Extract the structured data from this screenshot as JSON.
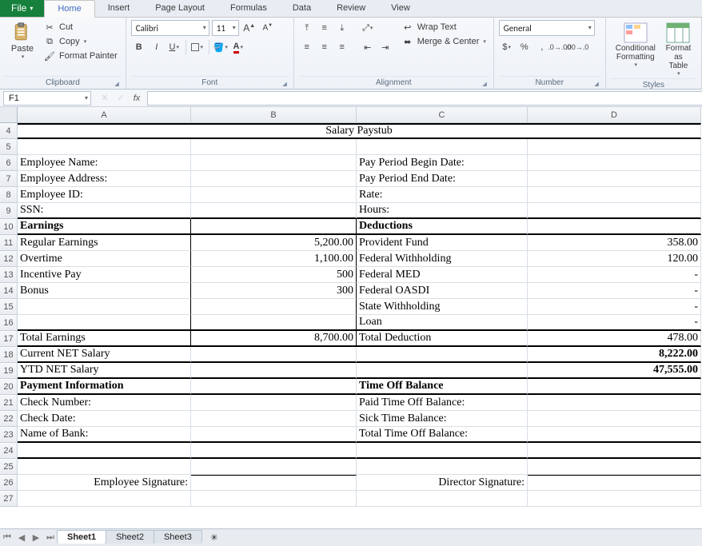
{
  "tabs": {
    "file": "File",
    "items": [
      "Home",
      "Insert",
      "Page Layout",
      "Formulas",
      "Data",
      "Review",
      "View"
    ],
    "active": "Home"
  },
  "ribbon": {
    "clipboard": {
      "label": "Clipboard",
      "paste": "Paste",
      "cut": "Cut",
      "copy": "Copy",
      "painter": "Format Painter"
    },
    "font": {
      "label": "Font",
      "family": "Calibri",
      "size": "11"
    },
    "alignment": {
      "label": "Alignment",
      "wrap": "Wrap Text",
      "merge": "Merge & Center"
    },
    "number": {
      "label": "Number",
      "format": "General"
    },
    "styles": {
      "label": "Styles",
      "cond": "Conditional Formatting",
      "table": "Format as Table"
    }
  },
  "formula_bar": {
    "cell_ref": "F1",
    "fx": "fx",
    "value": ""
  },
  "columns": [
    "A",
    "B",
    "C",
    "D"
  ],
  "rows": [
    "4",
    "5",
    "6",
    "7",
    "8",
    "9",
    "10",
    "11",
    "12",
    "13",
    "14",
    "15",
    "16",
    "17",
    "18",
    "19",
    "20",
    "21",
    "22",
    "23",
    "24",
    "25",
    "26",
    "27"
  ],
  "doc": {
    "title": "Salary Paystub",
    "r6a": "Employee Name:",
    "r6c": "Pay Period Begin Date:",
    "r7a": "Employee Address:",
    "r7c": "Pay Period End Date:",
    "r8a": "Employee ID:",
    "r8c": "Rate:",
    "r9a": "SSN:",
    "r9c": "Hours:",
    "r10a": "Earnings",
    "r10c": "Deductions",
    "r11a": "Regular Earnings",
    "r11b": "5,200.00",
    "r11c": "Provident Fund",
    "r11d": "358.00",
    "r12a": "Overtime",
    "r12b": "1,100.00",
    "r12c": "Federal Withholding",
    "r12d": "120.00",
    "r13a": "Incentive Pay",
    "r13b": "500",
    "r13c": "Federal MED",
    "r13d": "-",
    "r14a": "Bonus",
    "r14b": "300",
    "r14c": "Federal OASDI",
    "r14d": "-",
    "r15c": "State Withholding",
    "r15d": "-",
    "r16c": "Loan",
    "r16d": "-",
    "r17a": "Total Earnings",
    "r17b": "8,700.00",
    "r17c": "Total Deduction",
    "r17d": "478.00",
    "r18a": "Current NET Salary",
    "r18d": "8,222.00",
    "r19a": "YTD NET Salary",
    "r19d": "47,555.00",
    "r20a": "Payment Information",
    "r20c": "Time Off Balance",
    "r21a": "Check  Number:",
    "r21c": "Paid Time Off Balance:",
    "r22a": "Check Date:",
    "r22c": "Sick Time Balance:",
    "r23a": "Name of Bank:",
    "r23c": "Total Time Off Balance:",
    "r26a": "Employee Signature:",
    "r26c": "Director  Signature:"
  },
  "sheets": {
    "items": [
      "Sheet1",
      "Sheet2",
      "Sheet3"
    ],
    "active": "Sheet1"
  }
}
